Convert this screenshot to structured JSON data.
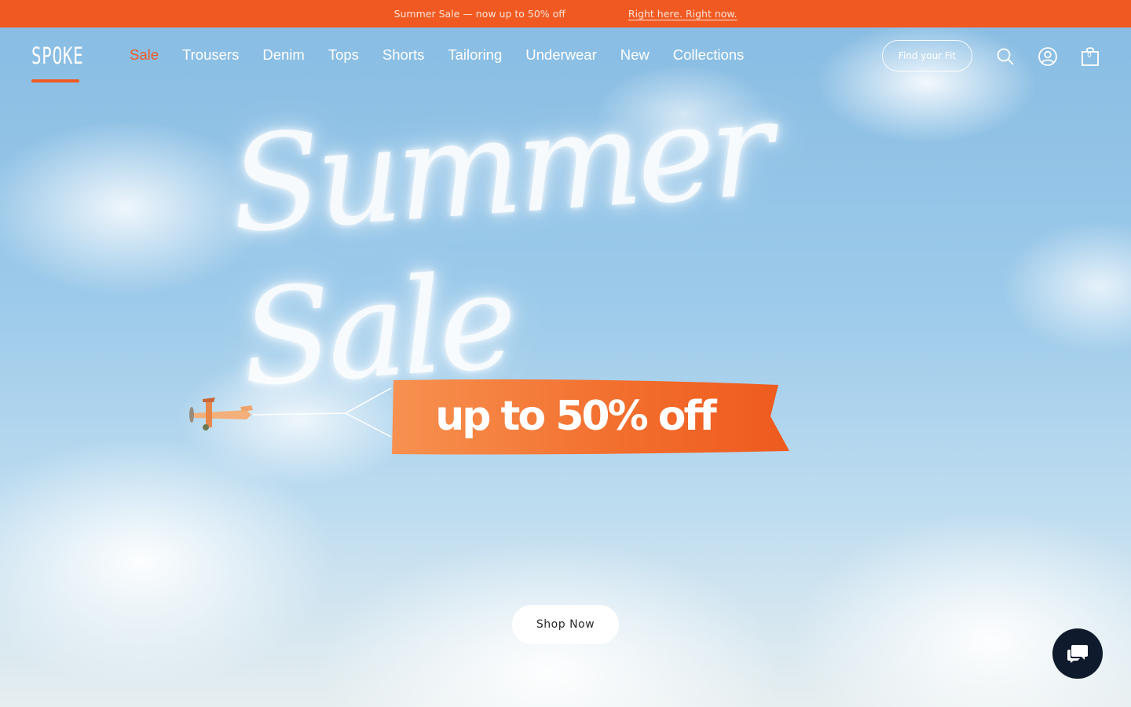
{
  "announcement": {
    "message": "Summer Sale — now up to 50% off",
    "link": "Right here. Right now."
  },
  "header": {
    "logo": "SPOKE",
    "nav": [
      {
        "label": "Sale",
        "active": true
      },
      {
        "label": "Trousers"
      },
      {
        "label": "Denim"
      },
      {
        "label": "Tops"
      },
      {
        "label": "Shorts"
      },
      {
        "label": "Tailoring"
      },
      {
        "label": "Underwear"
      },
      {
        "label": "New"
      },
      {
        "label": "Collections"
      }
    ],
    "find_fit_label": "Find your Fit",
    "icons": [
      "search-icon",
      "account-icon",
      "bag-icon"
    ],
    "cart_count": "0"
  },
  "hero": {
    "skywriting": "Summer Sale",
    "banner": "up to 50% off",
    "cta_label": "Shop Now"
  },
  "chat": {
    "icon": "chat-bubble-icon"
  },
  "colors": {
    "brand_orange": "#f05a22",
    "sky_blue": "#8fc3e8",
    "chat_navy": "#0f1b2d"
  }
}
